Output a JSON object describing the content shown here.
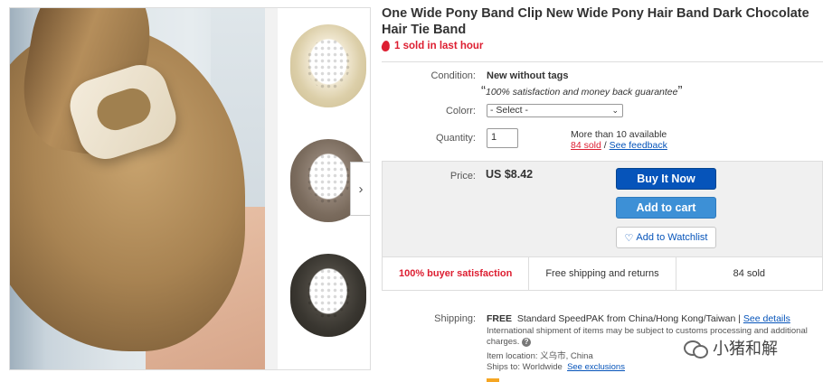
{
  "listing": {
    "title": "One Wide Pony Band Clip New Wide Pony Hair Band Dark Chocolate Hair Tie Band",
    "hot_text": "1 sold in last hour"
  },
  "condition": {
    "label": "Condition:",
    "value": "New without tags",
    "quote_open": "“",
    "quote_text": "100% satisfaction and money back guarantee",
    "quote_close": "”"
  },
  "color": {
    "label": "Colorr:",
    "selected": "- Select -"
  },
  "quantity": {
    "label": "Quantity:",
    "value": "1",
    "available": "More than 10 available",
    "sold_link": "84 sold",
    "separator": " / ",
    "feedback_link": "See feedback"
  },
  "price": {
    "label": "Price:",
    "value": "US $8.42"
  },
  "buttons": {
    "buy_now": "Buy It Now",
    "add_to_cart": "Add to cart",
    "watchlist": "Add to Watchlist"
  },
  "stats": [
    "100% buyer satisfaction",
    "Free shipping and returns",
    "84 sold"
  ],
  "shipping": {
    "label": "Shipping:",
    "free": "FREE",
    "method": "Standard SpeedPAK from China/Hong Kong/Taiwan",
    "sep": " | ",
    "details_link": "See details",
    "international": "International shipment of items may be subject to customs processing and additional charges.",
    "location": "Item location: 义乌市, China",
    "ships_to": "Ships to: Worldwide",
    "exclusions_link": "See exclusions"
  },
  "watermark": {
    "text": "小猪和解"
  },
  "icons": {
    "flame": "flame-icon",
    "heart": "heart-icon",
    "next": "chevron-right-icon",
    "question": "question-icon",
    "chat": "chat-bubbles-icon"
  },
  "colors": {
    "link": "#0654ba",
    "buy_button": "#0654ba",
    "cart_button": "#3d90d6",
    "alert_red": "#dd1e31",
    "price_panel": "#f0f0f0"
  }
}
